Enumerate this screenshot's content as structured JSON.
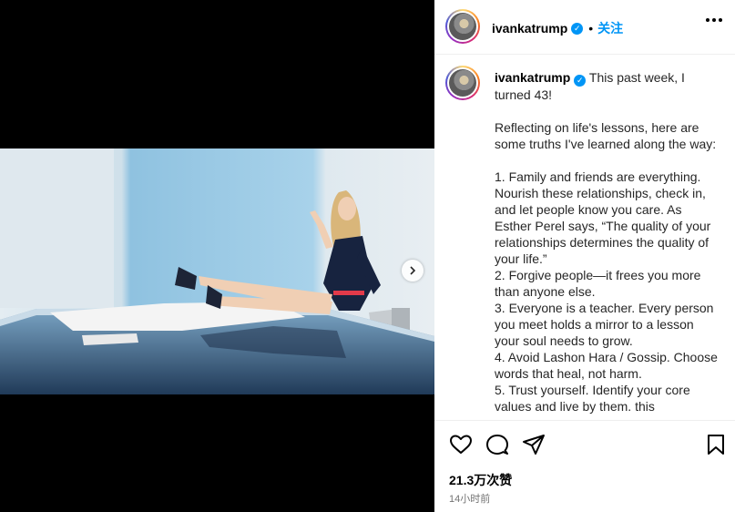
{
  "post": {
    "username": "ivankatrump",
    "separator": "•",
    "follow_label": "关注",
    "caption_username": "ivankatrump",
    "caption_text": "This past week, I turned 43!\n\nReflecting on life's lessons, here are some truths I've learned along the way:\n\n1. Family and friends are everything. Nourish these relationships, check in, and let people know you care. As Esther Perel says, “The quality of your relationships determines the quality of your life.”\n2. Forgive people—it frees you more than anyone else.\n3. Everyone is a teacher. Every person you meet holds a mirror to a lesson your soul needs to grow.\n4. Avoid Lashon Hara / Gossip. Choose words that heal, not harm.\n5. Trust yourself. Identify your core values and live by them. this",
    "likes": "21.3万次赞",
    "time_ago": "14小时前"
  },
  "icons": {
    "verified": "verified-badge-icon",
    "more": "more-options-icon",
    "like": "heart-icon",
    "comment": "comment-icon",
    "share": "share-icon",
    "save": "bookmark-icon",
    "next": "chevron-right-icon"
  },
  "colors": {
    "accent": "#0095f6",
    "media_bg": "#000000",
    "text": "#262626",
    "muted": "#737373"
  }
}
